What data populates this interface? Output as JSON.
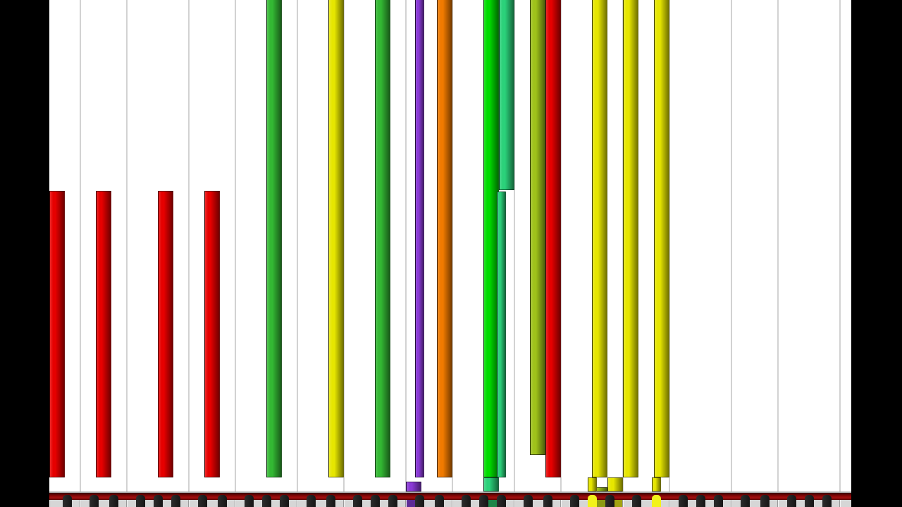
{
  "notes": [
    {
      "color": "#e60000"
    },
    {
      "color": "#e60000"
    },
    {
      "color": "#e60000"
    },
    {
      "color": "#e60000"
    },
    {
      "color": "#33b833"
    },
    {
      "color": "#e6e600"
    },
    {
      "color": "#33b833"
    },
    {
      "color": "#8a3ad6"
    },
    {
      "color": "#8a3ad6"
    },
    {
      "color": "#f07a00"
    },
    {
      "color": "#00dc00"
    },
    {
      "color": "#2bd17a"
    },
    {
      "color": "#2bd17a"
    },
    {
      "color": "#2bd17a"
    },
    {
      "color": "#9fc21a"
    },
    {
      "color": "#e60000"
    },
    {
      "color": "#e6e600"
    },
    {
      "color": "#9fc21a"
    },
    {
      "color": "#e6e600"
    },
    {
      "color": "#e6e600"
    },
    {
      "color": "#e6e600"
    },
    {
      "color": "#e6e600"
    },
    {
      "color": "#e6e600"
    }
  ],
  "keyboard": {
    "lit_keys": [
      {
        "color": "#5e2b96"
      },
      {
        "color": "#1d8548"
      },
      {
        "color": "#f2f21a"
      },
      {
        "color": "#8c9a12"
      },
      {
        "color": "#a3a312"
      },
      {
        "color": "#f2f21a"
      }
    ]
  }
}
